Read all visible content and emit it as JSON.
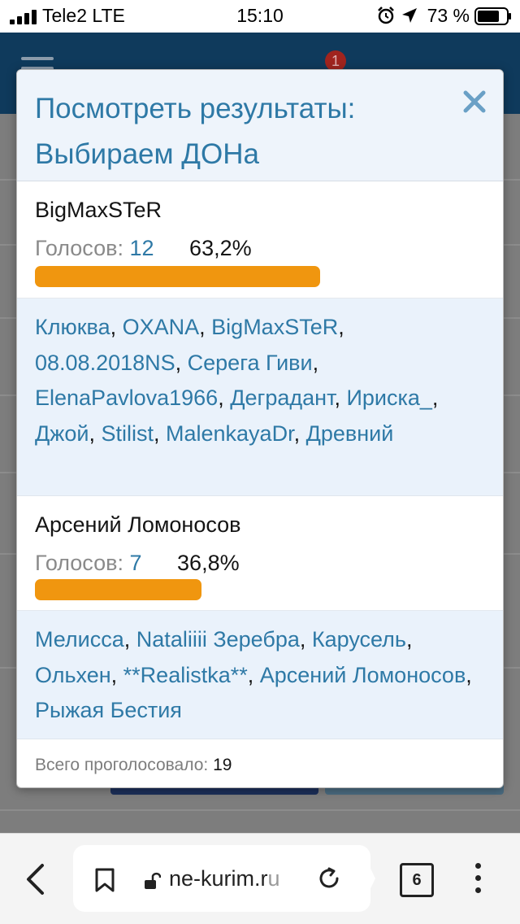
{
  "status_bar": {
    "carrier": "Tele2  LTE",
    "time": "15:10",
    "battery": "73 %"
  },
  "background_page": {
    "notification_count": "1"
  },
  "modal": {
    "title_line1": "Посмотреть результаты:",
    "title_line2": "Выбираем ДОНа",
    "options": [
      {
        "name": "BigMaxSTeR",
        "votes_label": "Голосов: ",
        "votes": "12",
        "percent": "63,2%",
        "bar_fraction": 0.632,
        "voters": [
          "Клюква",
          "OXANA",
          "BigMaxSTeR",
          "08.08.2018NS",
          "Серега Гиви",
          "ElenaPavlova1966",
          "Деградант",
          "Ириска_",
          "Джой",
          "Stilist",
          "MalenkayaDr",
          "Древний"
        ]
      },
      {
        "name": "Арсений Ломоносов",
        "votes_label": "Голосов: ",
        "votes": "7",
        "percent": "36,8%",
        "bar_fraction": 0.368,
        "voters": [
          "Мелисса",
          "Nataliiii Зеребра",
          "Карусель",
          "Ольхен",
          "**Realistka**",
          "Арсений Ломоносов",
          "Рыжая Бестия"
        ]
      }
    ],
    "total_label": "Всего проголосовало: ",
    "total_value": "19"
  },
  "browser": {
    "url_main": "ne-kurim.r",
    "url_faded": "u",
    "tab_count": "6"
  },
  "colors": {
    "link": "#2e79a6",
    "bar": "#f0960f",
    "header_bg": "#eef4fb",
    "voters_bg": "#eaf2fb"
  }
}
